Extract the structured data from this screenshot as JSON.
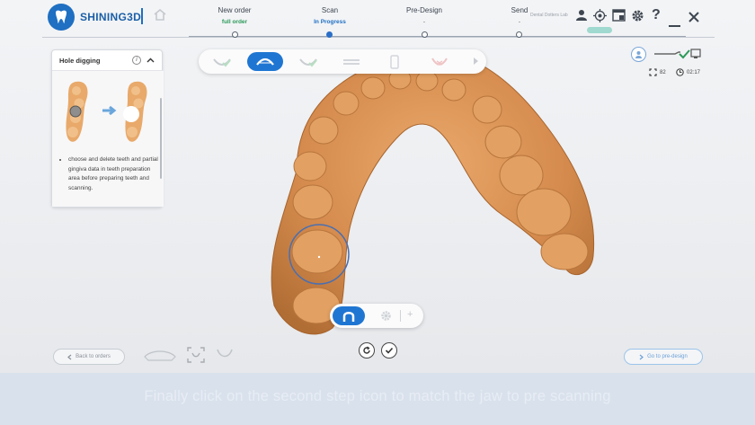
{
  "app": {
    "brand": "SHINING3D"
  },
  "header": {
    "steps": [
      {
        "title": "New order",
        "sub": "full order",
        "state": "done"
      },
      {
        "title": "Scan",
        "sub": "In Progress",
        "state": "active"
      },
      {
        "title": "Pre-Design",
        "sub": "-",
        "state": "pending"
      },
      {
        "title": "Send",
        "sub": "-",
        "state": "pending"
      }
    ],
    "dentist_name": "Dental Dotters Lab",
    "icons": [
      "user-icon",
      "crosshair-icon",
      "window-icon",
      "settings-icon",
      "help-icon",
      "minimize-icon",
      "close-icon"
    ]
  },
  "info_panel": {
    "title": "Hole digging",
    "description": "choose and delete teeth and partial gingiva data in teeth preparation area before preparing teeth and scanning."
  },
  "toolbar": {
    "tools": [
      "check-scan-tool",
      "upper-jaw-tool",
      "check-lower-tool",
      "bite-tool",
      "phone-tool",
      "trim-tool"
    ],
    "active_index": 1
  },
  "status": {
    "count": "82",
    "time": "02:17"
  },
  "navigation": {
    "back_label": "Back to orders",
    "next_label": "Go to pre-design"
  },
  "subtitle": "Finally click on the second step icon to match the jaw to pre scanning",
  "colors": {
    "brand_blue": "#1f6fc2",
    "active_blue": "#1f76d2",
    "done_green": "#2c9a5a",
    "scan_orange": "#d08a4c"
  }
}
